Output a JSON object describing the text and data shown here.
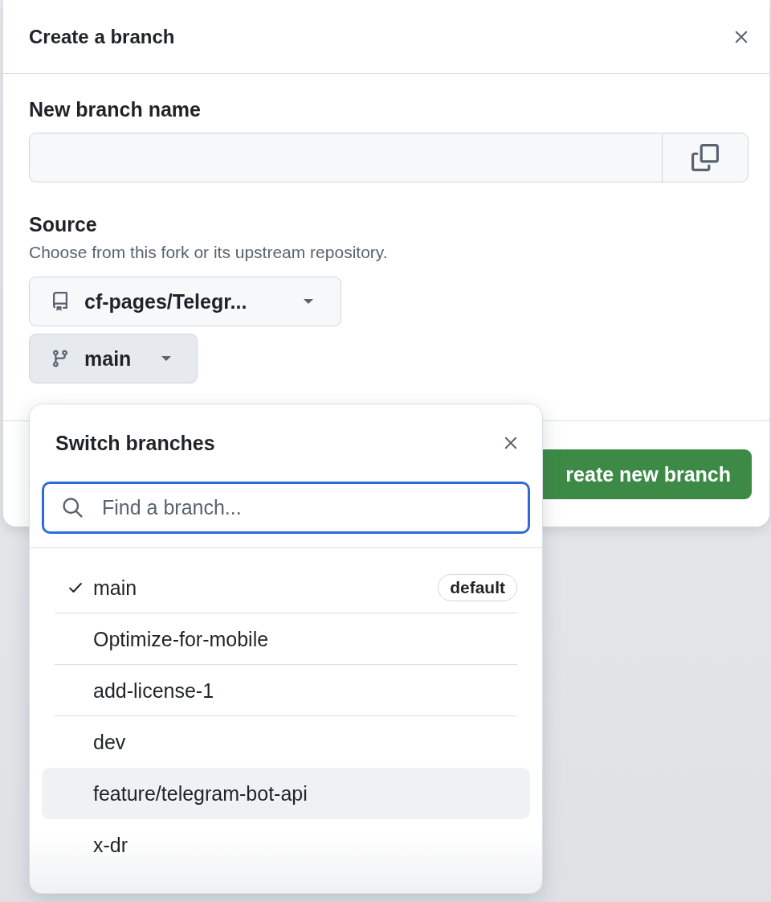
{
  "dialog": {
    "title": "Create a branch",
    "name_label": "New branch name",
    "source_label": "Source",
    "source_description": "Choose from this fork or its upstream repository.",
    "repository": "cf-pages/Telegr...",
    "branch": "main",
    "branch_pressed": true,
    "submit": "reate new branch"
  },
  "branch_menu": {
    "title": "Switch branches",
    "search": {
      "placeholder": "Find a branch..."
    },
    "items": [
      {
        "name": "main",
        "selected": true,
        "highlighted": false,
        "badge": "default"
      },
      {
        "name": "Optimize-for-mobile",
        "selected": false,
        "highlighted": false
      },
      {
        "name": "add-license-1",
        "selected": false,
        "highlighted": false
      },
      {
        "name": "dev",
        "selected": false,
        "highlighted": false
      },
      {
        "name": "feature/telegram-bot-api",
        "selected": false,
        "highlighted": true
      },
      {
        "name": "x-dr",
        "selected": false,
        "highlighted": false
      }
    ]
  }
}
